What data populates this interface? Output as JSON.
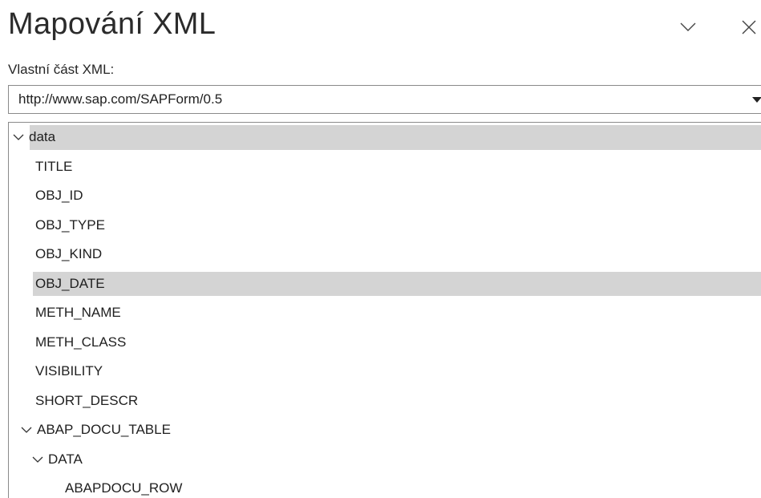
{
  "pane": {
    "title": "Mapování XML",
    "menu_icon": "chevron-down-icon",
    "close_icon": "close-icon"
  },
  "custom_xml_part": {
    "label": "Vlastní část XML:",
    "selected": "http://www.sap.com/SAPForm/0.5",
    "dropdown_icon": "triangle-down-icon"
  },
  "tree": {
    "highlight_color": "#d4d4d4",
    "nodes": [
      {
        "label": "data",
        "level": 0,
        "expanded": true,
        "selected": true
      },
      {
        "label": "TITLE",
        "level": 1
      },
      {
        "label": "OBJ_ID",
        "level": 1
      },
      {
        "label": "OBJ_TYPE",
        "level": 1
      },
      {
        "label": "OBJ_KIND",
        "level": 1
      },
      {
        "label": "OBJ_DATE",
        "level": 1,
        "hovered": true
      },
      {
        "label": "METH_NAME",
        "level": 1
      },
      {
        "label": "METH_CLASS",
        "level": 1
      },
      {
        "label": "VISIBILITY",
        "level": 1
      },
      {
        "label": "SHORT_DESCR",
        "level": 1
      },
      {
        "label": "ABAP_DOCU_TABLE",
        "level": 1,
        "expanded": true,
        "toggle": true
      },
      {
        "label": "DATA",
        "level": 2,
        "expanded": true,
        "toggle": true
      },
      {
        "label": "ABAPDOCU_ROW",
        "level": 3
      }
    ]
  }
}
